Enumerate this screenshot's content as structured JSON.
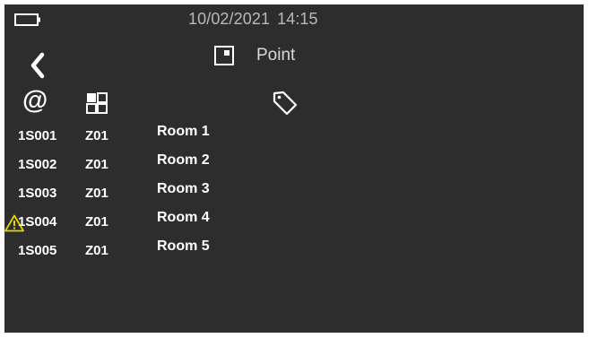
{
  "status_bar": {
    "date": "10/02/2021",
    "time": "14:15",
    "battery_icon": "battery-empty-icon"
  },
  "header": {
    "back_icon": "chevron-left-icon",
    "mode_icon": "point-square-icon",
    "mode_label": "Point"
  },
  "columns": {
    "address_icon": "at-sign-icon",
    "zone_icon": "grid-icon",
    "name_icon": "tag-icon"
  },
  "points": [
    {
      "address": "1S001",
      "zone": "Z01",
      "warning": false,
      "name": "Room 1"
    },
    {
      "address": "1S002",
      "zone": "Z01",
      "warning": false,
      "name": "Room 2"
    },
    {
      "address": "1S003",
      "zone": "Z01",
      "warning": false,
      "name": "Room 3"
    },
    {
      "address": "1S004",
      "zone": "Z01",
      "warning": true,
      "name": "Room 4"
    },
    {
      "address": "1S005",
      "zone": "Z01",
      "warning": false,
      "name": "Room 5"
    }
  ],
  "colors": {
    "background": "#2d2d2d",
    "text": "#ffffff",
    "muted_text": "#b9b9b9",
    "warning": "#e8d400"
  }
}
